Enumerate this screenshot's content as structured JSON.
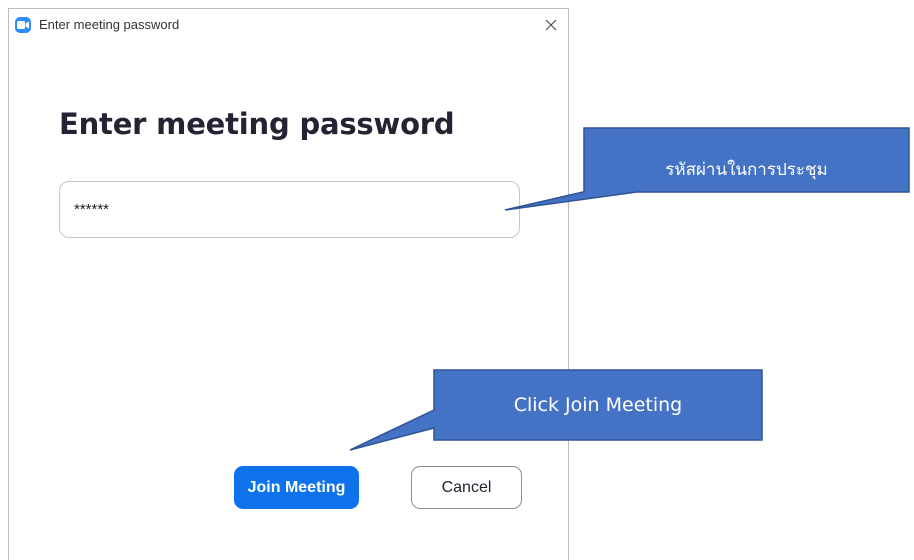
{
  "window": {
    "title": "Enter meeting password",
    "app_icon": "zoom-camera-icon",
    "close_icon": "close-icon"
  },
  "main": {
    "heading": "Enter meeting password",
    "password_value": "******",
    "join_label": "Join Meeting",
    "cancel_label": "Cancel"
  },
  "annotations": {
    "password_callout": "รหัสผ่านในการประชุม",
    "join_callout": "Click Join Meeting"
  },
  "colors": {
    "accent": "#0e72ed",
    "callout_fill": "#4472c4",
    "callout_border": "#2f5496"
  }
}
